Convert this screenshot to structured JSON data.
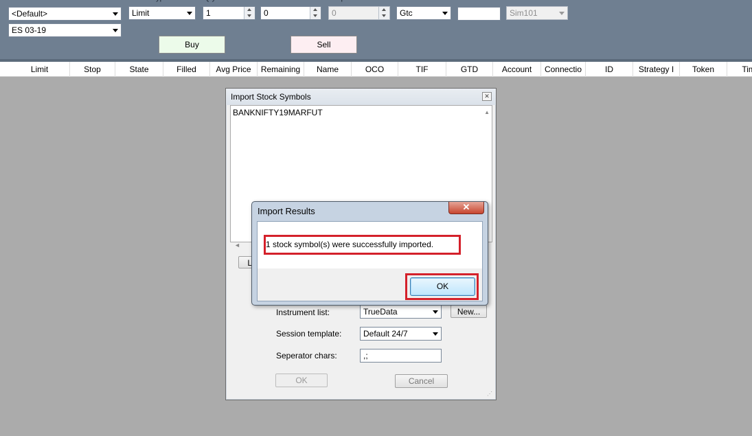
{
  "toolbar": {
    "atm_strategy": "<Default>",
    "instrument": "ES 03-19",
    "order_type": "Limit",
    "qty": "1",
    "limit_price": "0",
    "stop_price": "0",
    "tif": "Gtc",
    "oco": "",
    "account": "Sim101",
    "buy_label": "Buy",
    "sell_label": "Sell",
    "buy_color": "#ecfbea",
    "sell_color": "#fdeef2"
  },
  "grid": {
    "columns": [
      "Limit",
      "Stop",
      "State",
      "Filled",
      "Avg Price",
      "Remaining",
      "Name",
      "OCO",
      "TIF",
      "GTD",
      "Account",
      "Connectio",
      "ID",
      "Strategy I",
      "Token",
      "Time"
    ]
  },
  "import_dialog": {
    "title": "Import Stock Symbols",
    "symbols_text": "BANKNIFTY19MARFUT",
    "load_button_partial": "Lo",
    "instrument_list_label": "Instrument list:",
    "instrument_list_value": "TrueData",
    "new_button": "New...",
    "session_template_label": "Session template:",
    "session_template_value": "Default 24/7",
    "separator_label": "Seperator chars:",
    "separator_value": ",;",
    "ok_label": "OK",
    "cancel_label": "Cancel"
  },
  "results_dialog": {
    "title": "Import Results",
    "message": "1 stock symbol(s) were successfully imported.",
    "ok_label": "OK",
    "highlight_color": "#d4202a"
  }
}
